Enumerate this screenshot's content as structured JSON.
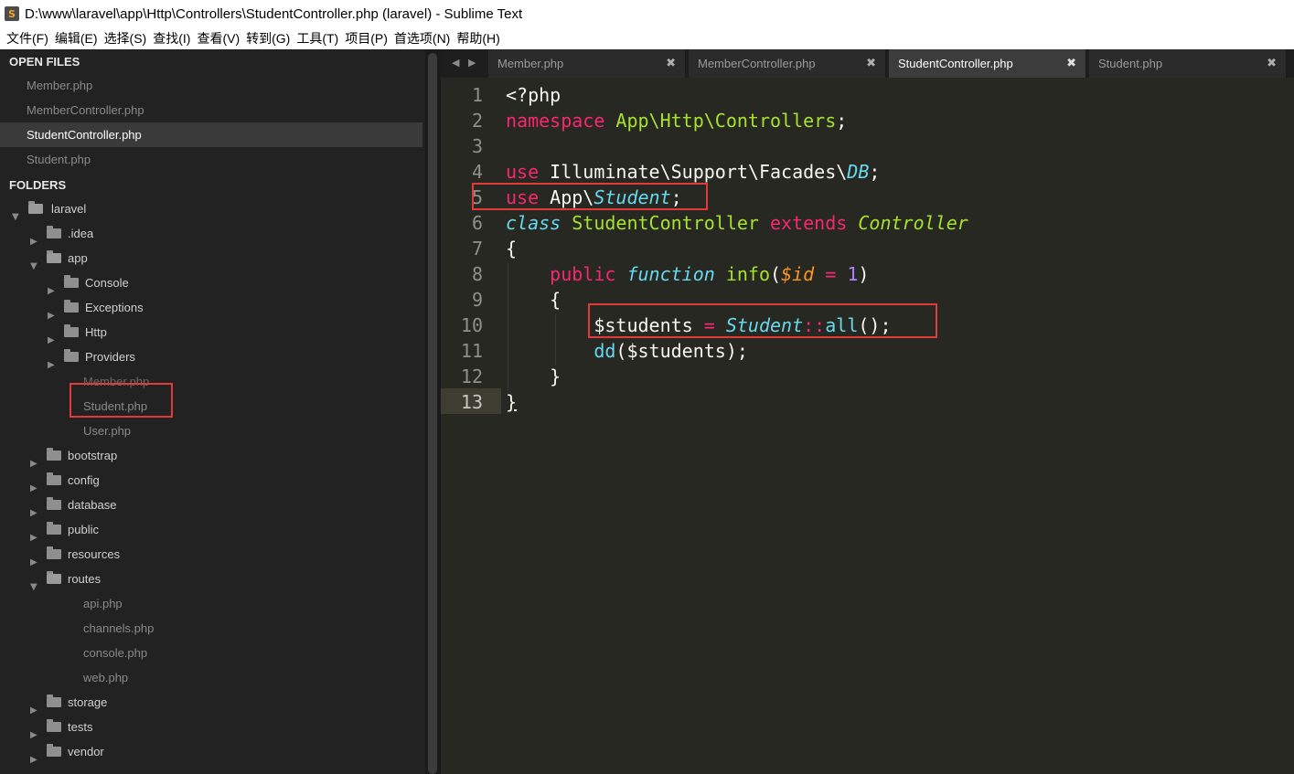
{
  "window": {
    "title": "D:\\www\\laravel\\app\\Http\\Controllers\\StudentController.php (laravel) - Sublime Text",
    "app_icon": "S"
  },
  "menu": [
    "文件(F)",
    "编辑(E)",
    "选择(S)",
    "查找(I)",
    "查看(V)",
    "转到(G)",
    "工具(T)",
    "项目(P)",
    "首选项(N)",
    "帮助(H)"
  ],
  "sidebar": {
    "open_files_header": "OPEN FILES",
    "open_files": [
      "Member.php",
      "MemberController.php",
      "StudentController.php",
      "Student.php"
    ],
    "folders_header": "FOLDERS",
    "tree": {
      "laravel": "laravel",
      "idea": ".idea",
      "app": "app",
      "console": "Console",
      "exceptions": "Exceptions",
      "http": "Http",
      "providers": "Providers",
      "member_php": "Member.php",
      "student_php": "Student.php",
      "user_php": "User.php",
      "bootstrap": "bootstrap",
      "config": "config",
      "database": "database",
      "public": "public",
      "resources": "resources",
      "routes": "routes",
      "api_php": "api.php",
      "channels_php": "channels.php",
      "console_php": "console.php",
      "web_php": "web.php",
      "storage": "storage",
      "tests": "tests",
      "vendor": "vendor"
    }
  },
  "tabs": [
    {
      "label": "Member.php",
      "close": "✖"
    },
    {
      "label": "MemberController.php",
      "close": "✖"
    },
    {
      "label": "StudentController.php",
      "close": "✖"
    },
    {
      "label": "Student.php",
      "close": "✖"
    }
  ],
  "tab_nav": {
    "left": "◀",
    "right": "▶"
  },
  "editor": {
    "line_numbers": [
      "1",
      "2",
      "3",
      "4",
      "5",
      "6",
      "7",
      "8",
      "9",
      "10",
      "11",
      "12",
      "13"
    ],
    "code": {
      "l1": "<?php",
      "l2_kw": "namespace",
      "l2_ns": "App\\Http\\Controllers",
      "l2_end": ";",
      "l4_kw": "use",
      "l4_ns": "Illuminate\\Support\\Facades\\",
      "l4_cls": "DB",
      "l4_end": ";",
      "l5_kw": "use",
      "l5_ns": "App\\",
      "l5_cls": "Student",
      "l5_end": ";",
      "l6_kw": "class",
      "l6_name": "StudentController",
      "l6_ext": "extends",
      "l6_parent": "Controller",
      "l7": "{",
      "l8_pub": "public",
      "l8_fn": "function",
      "l8_name": "info",
      "l8_open": "(",
      "l8_param": "$id",
      "l8_eq": "=",
      "l8_num": "1",
      "l8_close": ")",
      "l9": "{",
      "l10_var": "$students",
      "l10_eq": "=",
      "l10_cls": "Student",
      "l10_op": "::",
      "l10_m": "all",
      "l10_end": "();",
      "l11_fn": "dd",
      "l11_rest": "($students);",
      "l12": "}",
      "l13": "}"
    }
  },
  "colors": {
    "background": "#272822",
    "sidebar": "#222222",
    "keyword": "#f92672",
    "string_green": "#a6e22e",
    "type_blue": "#66d9ef",
    "number": "#ae81ff",
    "param": "#fd971f",
    "annotation_box": "#e03a3a"
  }
}
